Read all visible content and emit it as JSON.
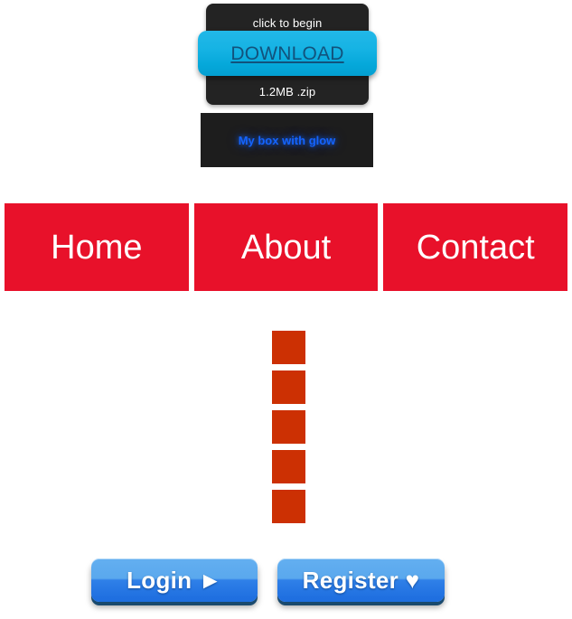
{
  "download_widget": {
    "caption_top": "click to begin",
    "caption_bottom": "1.2MB .zip",
    "button_label": "DOWNLOAD",
    "panel_color": "#232323",
    "button_color": "#16b3e4",
    "button_text_color": "#12527c"
  },
  "glow_box": {
    "label": "My box with glow",
    "background_color": "#1d1d1d",
    "text_color": "#1464ff"
  },
  "nav": {
    "accent_color": "#e8112a",
    "text_color": "#ffffff",
    "items": [
      {
        "label": "Home"
      },
      {
        "label": "About"
      },
      {
        "label": "Contact"
      }
    ]
  },
  "square_column": {
    "color": "#cc3003",
    "count": 5,
    "blocks": [
      {
        "index": 1
      },
      {
        "index": 2
      },
      {
        "index": 3
      },
      {
        "index": 4
      },
      {
        "index": 5
      }
    ]
  },
  "buttons": {
    "accent_color": "#2f80e8",
    "edge_color": "#1a4a6e",
    "login": {
      "label": "Login ►",
      "icon": "play-triangle-icon"
    },
    "register": {
      "label": "Register ♥",
      "icon": "heart-icon"
    }
  }
}
